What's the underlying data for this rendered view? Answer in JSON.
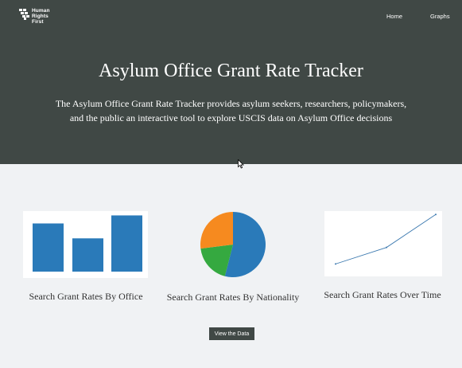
{
  "brand": {
    "logo_lines": [
      "Human",
      "Rights",
      "First"
    ]
  },
  "nav": {
    "home": "Home",
    "graphs": "Graphs"
  },
  "hero": {
    "title": "Asylum Office Grant Rate Tracker",
    "description": "The Asylum Office Grant Rate Tracker provides asylum seekers, researchers, policymakers, and the public an interactive tool to explore USCIS data on Asylum Office decisions"
  },
  "cards": {
    "office": {
      "label": "Search Grant Rates By Office",
      "icon": "bar-chart-thumbnail"
    },
    "nationality": {
      "label": "Search Grant Rates By Nationality",
      "icon": "pie-chart-thumbnail"
    },
    "time": {
      "label": "Search Grant Rates Over Time",
      "icon": "line-chart-thumbnail"
    }
  },
  "actions": {
    "view_data": "View the Data"
  },
  "colors": {
    "hero_bg": "#404845",
    "page_bg": "#f0f2f4",
    "bar_blue": "#2a7ab9",
    "pie_orange": "#f68a1f",
    "pie_green": "#35a940",
    "line_blue": "#3d7ab0"
  },
  "thumbnail_data": {
    "bars": [
      0.84,
      0.58,
      0.98
    ],
    "pie_slices": [
      {
        "name": "blue",
        "fraction": 0.54
      },
      {
        "name": "green",
        "fraction": 0.19
      },
      {
        "name": "orange",
        "fraction": 0.27
      }
    ],
    "line_points": [
      0.13,
      0.41,
      0.97
    ]
  }
}
